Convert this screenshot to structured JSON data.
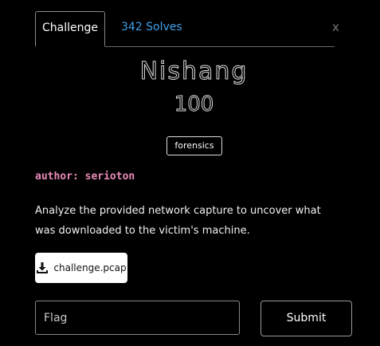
{
  "tabs": {
    "challenge_label": "Challenge",
    "solves_label": "342 Solves"
  },
  "close_label": "x",
  "challenge": {
    "name": "Nishang",
    "value": "100",
    "tag": "forensics",
    "author": "author: serioton",
    "description": "Analyze the provided network capture to uncover what was downloaded to the victim's machine.",
    "file_name": "challenge.pcap"
  },
  "flag": {
    "placeholder": "Flag",
    "value": ""
  },
  "submit_label": "Submit",
  "colors": {
    "background": "#000000",
    "link": "#3fa0e8",
    "author": "#e88ab8"
  },
  "icons": {
    "download": "download-icon",
    "close": "close-icon"
  }
}
